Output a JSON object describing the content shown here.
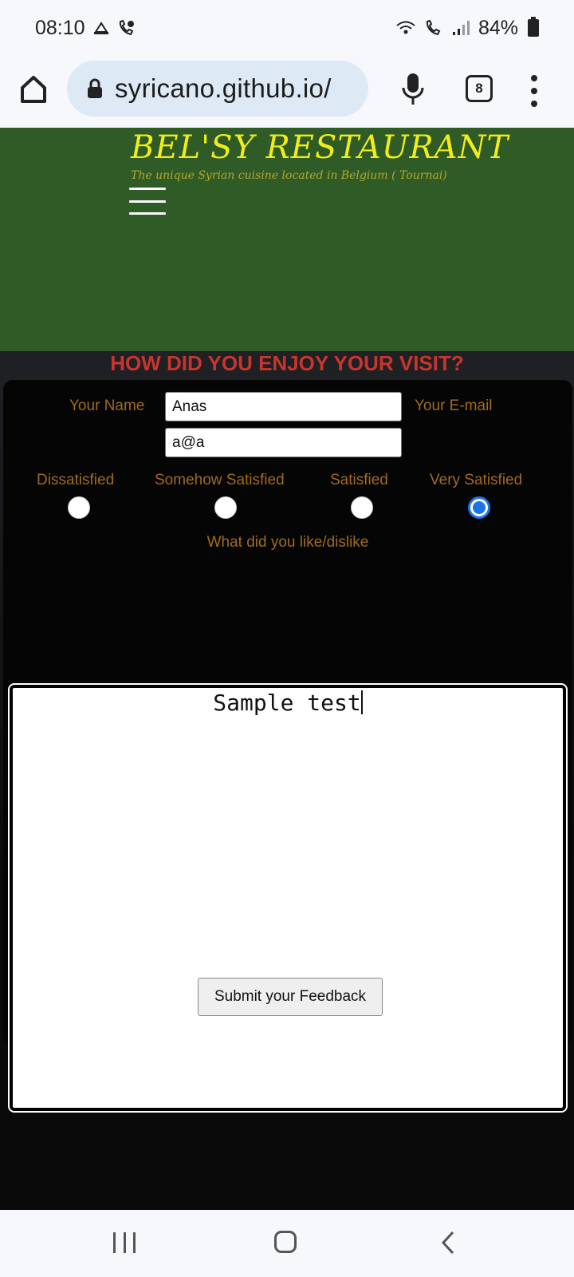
{
  "status_bar": {
    "time": "08:10",
    "battery_percent": "84%",
    "icons": [
      "navigation-app-icon",
      "call-icon",
      "wifi-icon",
      "call-icon",
      "signal-icon",
      "battery-icon"
    ]
  },
  "browser": {
    "url": "syricano.github.io/",
    "tab_count": "8",
    "icons": [
      "home-icon",
      "lock-icon",
      "mic-icon",
      "tabs-icon",
      "more-vert-icon"
    ]
  },
  "site": {
    "title": "BEL'SY RESTAURANT",
    "subtitle": "The unique Syrian cuisine located in Belgium ( Tournai)",
    "menu_icon": "hamburger-icon"
  },
  "feedback": {
    "heading": "HOW DID YOU ENJOY YOUR VISIT?",
    "name_label": "Your Name",
    "name_value": "Anas",
    "email_label": "Your E-mail",
    "email_value": "a@a",
    "ratings": [
      {
        "label": "Dissatisfied",
        "checked": false
      },
      {
        "label": "Somehow Satisfied",
        "checked": false
      },
      {
        "label": "Satisfied",
        "checked": false
      },
      {
        "label": "Very Satisfied",
        "checked": true
      }
    ],
    "comment_label": "What did you like/dislike",
    "comment_value": "Sample test",
    "submit_label": "Submit your Feedback"
  },
  "nav_bar": {
    "icons": [
      "recents-icon",
      "home-icon",
      "back-icon"
    ]
  },
  "colors": {
    "hero_green": "#2e5b26",
    "title_yellow": "#f2ed1a",
    "heading_red": "#c8352d",
    "label_brown": "#a06a20",
    "radio_blue": "#1a73e8"
  }
}
